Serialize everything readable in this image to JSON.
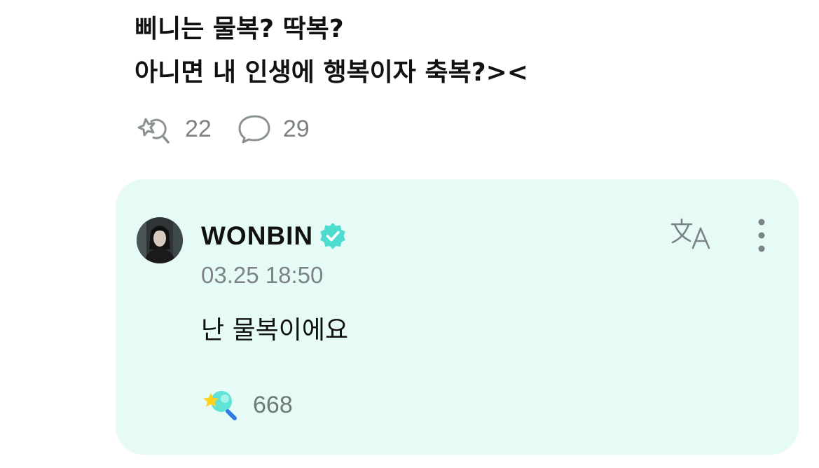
{
  "post": {
    "lines": [
      "삐니는 물복? 딱복?",
      "아니면 내 인생에 행복이자 축복?><"
    ],
    "reactions_count": "22",
    "comments_count": "29"
  },
  "reply": {
    "author": "WONBIN",
    "verified_icon": "verified-badge-icon",
    "timestamp": "03.25 18:50",
    "text": "난 물복이에요",
    "reaction_count": "668",
    "actions": {
      "translate_icon": "translate-icon",
      "more_icon": "more-vertical-icon"
    }
  },
  "colors": {
    "card_background": "#e7fbf6",
    "accent": "#4fdcd0",
    "muted_text": "#7c8385",
    "primary_text": "#111111"
  }
}
